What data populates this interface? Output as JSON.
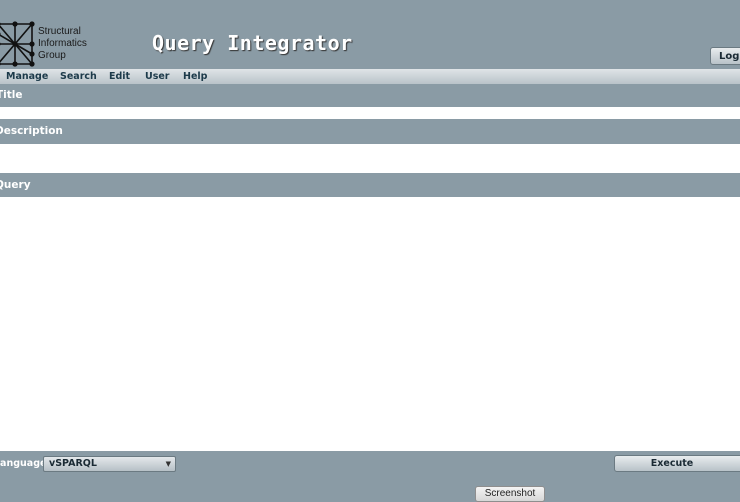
{
  "header": {
    "logo_lines": [
      "Structural",
      "Informatics",
      "Group"
    ],
    "app_title": "Query Integrator",
    "login_label": "Login"
  },
  "menu": {
    "items": [
      "Manage",
      "Search",
      "Edit",
      "User",
      "Help"
    ]
  },
  "sections": {
    "title_label": "Title",
    "title_value": "",
    "description_label": "Description",
    "description_value": "",
    "query_label": "Query",
    "query_value": ""
  },
  "footer": {
    "language_label": "Language",
    "language_selected": "vSPARQL",
    "execute_label": "Execute",
    "screenshot_label": "Screenshot"
  },
  "colors": {
    "background": "#8a9ba5",
    "field": "#ffffff",
    "menu_text": "#1c3a4a"
  }
}
